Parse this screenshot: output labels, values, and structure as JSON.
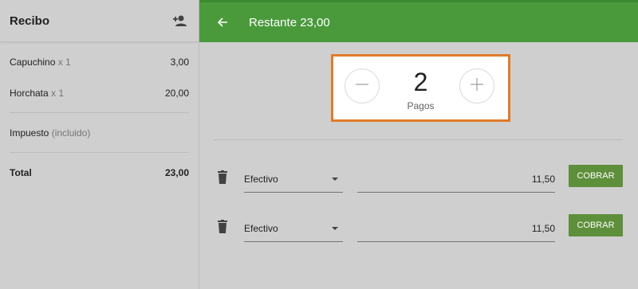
{
  "receipt": {
    "title": "Recibo",
    "add_customer_icon": "person-add-icon",
    "items": [
      {
        "name": "Capuchino",
        "qty": "x 1",
        "price": "3,00"
      },
      {
        "name": "Horchata",
        "qty": "x 1",
        "price": "20,00"
      }
    ],
    "tax": {
      "label": "Impuesto",
      "note": "(incluido)"
    },
    "total": {
      "label": "Total",
      "value": "23,00"
    }
  },
  "topbar": {
    "back_icon": "arrow-back-icon",
    "title": "Restante 23,00",
    "color": "#4a9a3c"
  },
  "payments_counter": {
    "value": "2",
    "label": "Pagos",
    "decrement_icon": "minus-icon",
    "increment_icon": "plus-icon",
    "highlight_color": "#e07b2a"
  },
  "payments": [
    {
      "method": "Efectivo",
      "amount": "11,50",
      "action": "COBRAR"
    },
    {
      "method": "Efectivo",
      "amount": "11,50",
      "action": "COBRAR"
    }
  ],
  "colors": {
    "accent": "#5e8f3a",
    "background": "#cfcfcf"
  }
}
